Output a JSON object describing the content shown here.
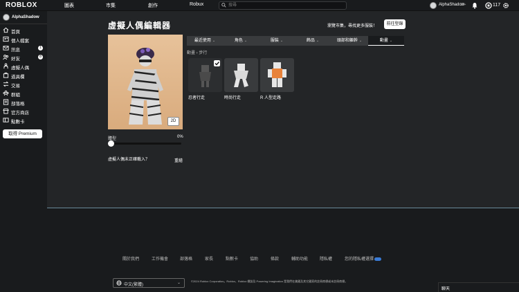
{
  "topbar": {
    "logo": "ROBLOX",
    "nav": [
      "圖表",
      "市集",
      "創作",
      "Robux"
    ],
    "search_placeholder": "搜尋",
    "username": "AlphaShadow",
    "age_label": "13+",
    "robux_count": "117"
  },
  "sidebar": {
    "username": "AlphaShadow",
    "items": [
      {
        "label": "首頁",
        "icon": "home-icon"
      },
      {
        "label": "個人檔案",
        "icon": "profile-icon"
      },
      {
        "label": "訊息",
        "icon": "message-icon",
        "badge": "1"
      },
      {
        "label": "好友",
        "icon": "friends-icon",
        "badge": "8"
      },
      {
        "label": "虛擬人偶",
        "icon": "avatar-icon"
      },
      {
        "label": "道具欄",
        "icon": "inventory-icon"
      },
      {
        "label": "交易",
        "icon": "trade-icon"
      },
      {
        "label": "群組",
        "icon": "groups-icon"
      },
      {
        "label": "部落格",
        "icon": "blog-icon"
      },
      {
        "label": "官方商店",
        "icon": "store-icon"
      },
      {
        "label": "點數卡",
        "icon": "giftcard-icon"
      }
    ],
    "premium_button": "取得 Premium"
  },
  "editor": {
    "title": "虛擬人偶編輯器",
    "browse_text": "瀏覽市集，尋找更多服裝！",
    "shop_button": "前往型錄",
    "view_2d": "2D",
    "body_type_label": "體型",
    "body_type_value": "0%",
    "not_loaded_text": "虛擬人偶未正確載入？",
    "redraw": "重繪",
    "tabs": [
      "最近使用",
      "角色",
      "服裝",
      "飾品",
      "頭部和軀幹",
      "動畫"
    ],
    "active_tab": "動畫",
    "breadcrumb": "動畫 › 步行",
    "items": [
      {
        "name": "忍者行走",
        "selected": true
      },
      {
        "name": "時尚行走",
        "selected": false
      },
      {
        "name": "R 人型走路",
        "selected": false
      }
    ]
  },
  "footer": {
    "links": [
      "關於我們",
      "工作機會",
      "部落格",
      "家長",
      "點數卡",
      "協助",
      "條款",
      "輔助功能",
      "隱私權",
      "您的隱私權選擇"
    ],
    "language": "中文(繁體)",
    "copyright": "©2024 Roblox Corporation。Roblox、Roblox 標誌及 Powering Imagination 是我們在美國及其它國家的註冊商標或未註冊商標。"
  },
  "chat": {
    "label": "聊天"
  }
}
